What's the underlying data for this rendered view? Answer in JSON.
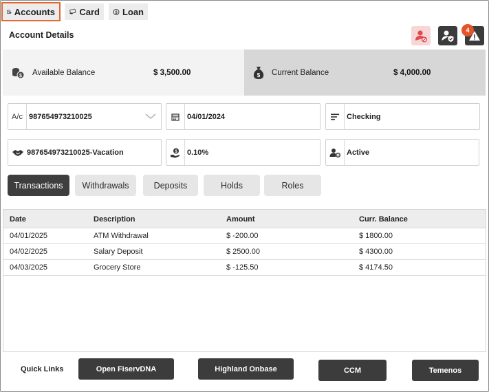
{
  "tabs": [
    {
      "label": "Accounts",
      "icon": "accounts-icon",
      "active": true
    },
    {
      "label": "Card",
      "icon": "card-icon",
      "active": false
    },
    {
      "label": "Loan",
      "icon": "loan-icon",
      "active": false
    }
  ],
  "header": {
    "title": "Account Details",
    "alert_count": "4"
  },
  "balances": {
    "available": {
      "label": "Available Balance",
      "value": "$ 3,500.00"
    },
    "current": {
      "label": "Current Balance",
      "value": "$ 4,000.00"
    }
  },
  "fields": {
    "account_prefix": "A/c",
    "account_number": "987654973210025",
    "date": "04/01/2024",
    "account_type": "Checking",
    "nickname": "987654973210025-Vacation",
    "rate": "0.10%",
    "status": "Active"
  },
  "sub_tabs": [
    "Transactions",
    "Withdrawals",
    "Deposits",
    "Holds",
    "Roles"
  ],
  "table": {
    "columns": [
      "Date",
      "Description",
      "Amount",
      "Curr. Balance"
    ],
    "rows": [
      [
        "04/01/2025",
        "ATM Withdrawal",
        "$ -200.00",
        "$ 1800.00"
      ],
      [
        "04/02/2025",
        "Salary Deposit",
        "$ 2500.00",
        "$ 4300.00"
      ],
      [
        "04/03/2025",
        "Grocery Store",
        "$ -125.50",
        "$ 4174.50"
      ]
    ]
  },
  "quick_links": {
    "label": "Quick Links",
    "buttons": [
      "Open FiservDNA",
      "Highland Onbase",
      "CCM",
      "Temenos"
    ]
  },
  "colors": {
    "active_tab_outline": "#e2682f",
    "badge": "#e2542a",
    "dark_button": "#3c3c3c",
    "blocked_user_icon": "#e04b4b"
  }
}
